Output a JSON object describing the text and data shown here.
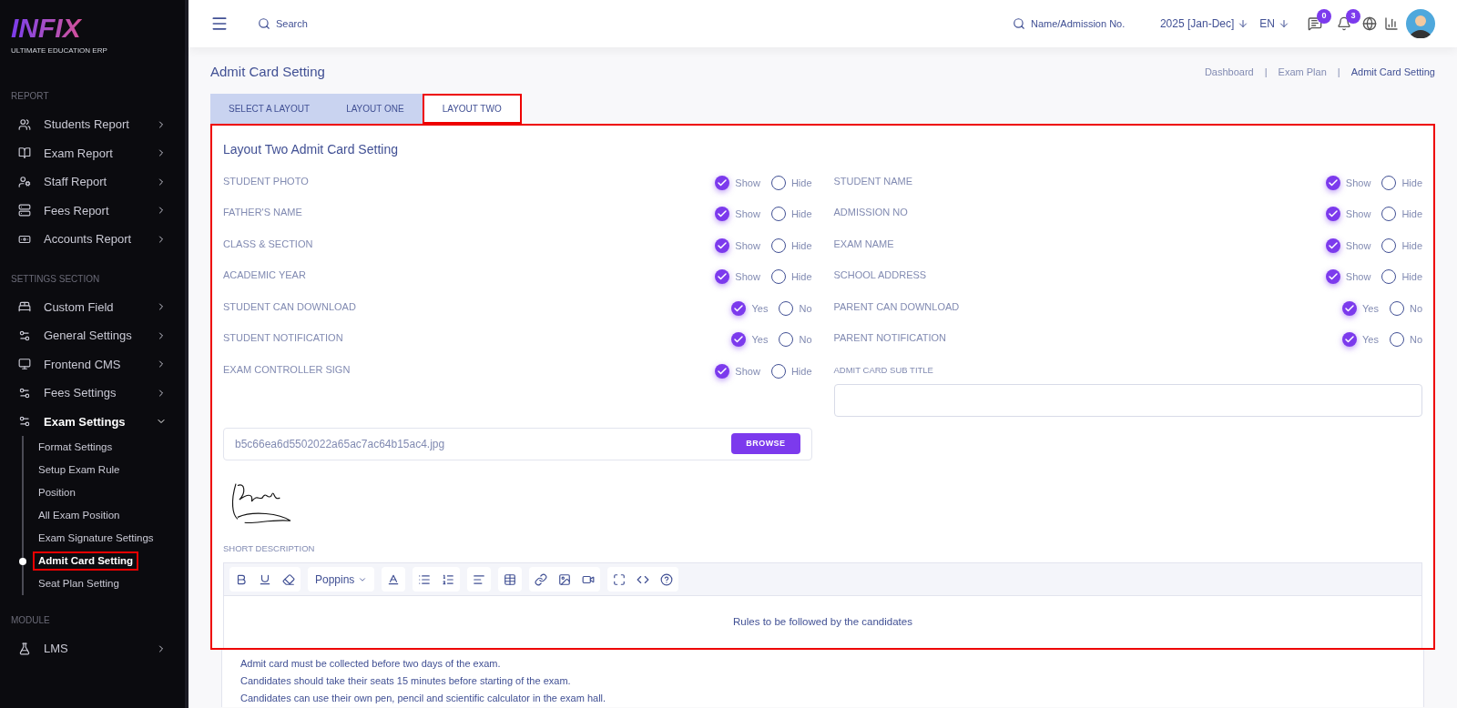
{
  "logo": {
    "name": "INFIX",
    "tagline": "ULTIMATE EDUCATION ERP"
  },
  "sidebar": {
    "sections": [
      {
        "title": "REPORT",
        "items": [
          {
            "label": "Students Report",
            "expanded": false
          },
          {
            "label": "Exam Report",
            "expanded": false
          },
          {
            "label": "Staff Report",
            "expanded": false
          },
          {
            "label": "Fees Report",
            "expanded": false
          },
          {
            "label": "Accounts Report",
            "expanded": false
          }
        ]
      },
      {
        "title": "SETTINGS SECTION",
        "items": [
          {
            "label": "Custom Field",
            "expanded": false
          },
          {
            "label": "General Settings",
            "expanded": false
          },
          {
            "label": "Frontend CMS",
            "expanded": false
          },
          {
            "label": "Fees Settings",
            "expanded": false
          },
          {
            "label": "Exam Settings",
            "expanded": true,
            "children": [
              {
                "label": "Format Settings",
                "selected": false,
                "highlighted": false
              },
              {
                "label": "Setup Exam Rule",
                "selected": false,
                "highlighted": false
              },
              {
                "label": "Position",
                "selected": false,
                "highlighted": false
              },
              {
                "label": "All Exam Position",
                "selected": false,
                "highlighted": false
              },
              {
                "label": "Exam Signature Settings",
                "selected": false,
                "highlighted": false
              },
              {
                "label": "Admit Card Setting",
                "selected": true,
                "highlighted": true
              },
              {
                "label": "Seat Plan Setting",
                "selected": false,
                "highlighted": false
              }
            ]
          }
        ]
      },
      {
        "title": "MODULE",
        "items": [
          {
            "label": "LMS",
            "expanded": false
          }
        ]
      }
    ]
  },
  "header": {
    "search": {
      "placeholder": "Search"
    },
    "student_search": {
      "placeholder": "Name/Admission No."
    },
    "session": "2025 [Jan-Dec]",
    "language": "EN",
    "messages_count": "0",
    "notifications_count": "3"
  },
  "page": {
    "title": "Admit Card Setting",
    "breadcrumb": [
      "Dashboard",
      "Exam Plan",
      "Admit Card Setting"
    ],
    "breadcrumb_separator": "|"
  },
  "tabs": [
    {
      "label": "SELECT A LAYOUT",
      "selected": false,
      "highlighted": false
    },
    {
      "label": "LAYOUT ONE",
      "selected": false,
      "highlighted": false
    },
    {
      "label": "LAYOUT TWO",
      "selected": true,
      "highlighted": true
    }
  ],
  "form": {
    "title": "Layout Two Admit Card Setting",
    "highlighted": true,
    "left": [
      {
        "label": "STUDENT PHOTO",
        "options": [
          {
            "label": "Show",
            "selected": true
          },
          {
            "label": "Hide",
            "selected": false
          }
        ]
      },
      {
        "label": "FATHER'S NAME",
        "options": [
          {
            "label": "Show",
            "selected": true
          },
          {
            "label": "Hide",
            "selected": false
          }
        ]
      },
      {
        "label": "CLASS & SECTION",
        "options": [
          {
            "label": "Show",
            "selected": true
          },
          {
            "label": "Hide",
            "selected": false
          }
        ]
      },
      {
        "label": "ACADEMIC YEAR",
        "options": [
          {
            "label": "Show",
            "selected": true
          },
          {
            "label": "Hide",
            "selected": false
          }
        ]
      },
      {
        "label": "STUDENT CAN DOWNLOAD",
        "options": [
          {
            "label": "Yes",
            "selected": true
          },
          {
            "label": "No",
            "selected": false
          }
        ]
      },
      {
        "label": "STUDENT NOTIFICATION",
        "options": [
          {
            "label": "Yes",
            "selected": true
          },
          {
            "label": "No",
            "selected": false
          }
        ]
      },
      {
        "label": "EXAM CONTROLLER SIGN",
        "options": [
          {
            "label": "Show",
            "selected": true
          },
          {
            "label": "Hide",
            "selected": false
          }
        ]
      }
    ],
    "right": [
      {
        "label": "STUDENT NAME",
        "options": [
          {
            "label": "Show",
            "selected": true
          },
          {
            "label": "Hide",
            "selected": false
          }
        ]
      },
      {
        "label": "ADMISSION NO",
        "options": [
          {
            "label": "Show",
            "selected": true
          },
          {
            "label": "Hide",
            "selected": false
          }
        ]
      },
      {
        "label": "EXAM NAME",
        "options": [
          {
            "label": "Show",
            "selected": true
          },
          {
            "label": "Hide",
            "selected": false
          }
        ]
      },
      {
        "label": "SCHOOL ADDRESS",
        "options": [
          {
            "label": "Show",
            "selected": true
          },
          {
            "label": "Hide",
            "selected": false
          }
        ]
      },
      {
        "label": "PARENT CAN DOWNLOAD",
        "options": [
          {
            "label": "Yes",
            "selected": true
          },
          {
            "label": "No",
            "selected": false
          }
        ]
      },
      {
        "label": "PARENT NOTIFICATION",
        "options": [
          {
            "label": "Yes",
            "selected": true
          },
          {
            "label": "No",
            "selected": false
          }
        ]
      }
    ],
    "sub_title": {
      "label": "ADMIT CARD SUB TITLE"
    },
    "file": {
      "value": "b5c66ea6d5502022a65ac7ac64b15ac4.jpg",
      "button": "BROWSE"
    },
    "description": {
      "label": "SHORT DESCRIPTION",
      "font": "Poppins",
      "heading": "Rules to be followed by the candidates",
      "lines": [
        "Admit card must be collected before two days of the exam.",
        "Candidates should take their seats 15 minutes before starting of the exam.",
        "Candidates can use their own pen, pencil and scientific calculator in the exam hall."
      ]
    }
  }
}
